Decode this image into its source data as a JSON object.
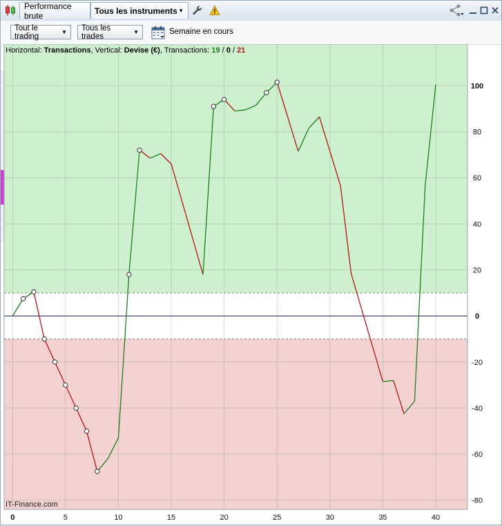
{
  "tabs": {
    "performance_label": "Performance brute",
    "instruments_label": "Tous les instruments"
  },
  "toolbar": {
    "trading_filter": "Tout le trading",
    "trades_filter": "Tous les trades",
    "period_label": "Semaine en cours"
  },
  "info": {
    "horizontal_prefix": "Horizontal: ",
    "horizontal_value": "Transactions",
    "vertical_prefix": ", Vertical: ",
    "vertical_value": "Devise (€)",
    "transactions_prefix": ", Transactions: ",
    "wins": "19",
    "sep1": " / ",
    "neutral": "0",
    "sep2": " / ",
    "losses": "21"
  },
  "brand": "IT-Finance.com",
  "colors": {
    "profit_zone": "#cef0ce",
    "loss_zone": "#f4d2d2",
    "up_line": "#1e7d1e",
    "down_line": "#b01414",
    "wins_text": "#1e7d1e",
    "losses_text": "#b01414"
  },
  "icons": {
    "chart": "candlestick-icon",
    "wrench": "wrench-icon",
    "warning": "warning-icon",
    "share": "share-icon",
    "calendar": "calendar-icon"
  },
  "chart_data": {
    "type": "line",
    "xlabel": "Transactions",
    "ylabel": "Devise (€)",
    "xlim": [
      -0.8,
      43
    ],
    "ylim": [
      -84,
      118
    ],
    "xticks": [
      "0",
      "5",
      "10",
      "15",
      "20",
      "25",
      "30",
      "35",
      "40"
    ],
    "yticks": [
      "100",
      "80",
      "60",
      "40",
      "20",
      "0",
      "-20",
      "-40",
      "-60",
      "-80"
    ],
    "profit_threshold": 10,
    "loss_threshold": -10,
    "grid": true,
    "points": [
      {
        "x": 0,
        "y": 0,
        "m": false
      },
      {
        "x": 1,
        "y": 7.5,
        "m": true
      },
      {
        "x": 2,
        "y": 10.5,
        "m": true
      },
      {
        "x": 3,
        "y": -10,
        "m": true
      },
      {
        "x": 4,
        "y": -20,
        "m": true
      },
      {
        "x": 5,
        "y": -30,
        "m": true
      },
      {
        "x": 6,
        "y": -40,
        "m": true
      },
      {
        "x": 7,
        "y": -50,
        "m": true
      },
      {
        "x": 8,
        "y": -67.5,
        "m": true
      },
      {
        "x": 9,
        "y": -62,
        "m": false
      },
      {
        "x": 10,
        "y": -53,
        "m": false
      },
      {
        "x": 11,
        "y": 18,
        "m": true
      },
      {
        "x": 12,
        "y": 72,
        "m": true
      },
      {
        "x": 13,
        "y": 68.5,
        "m": false
      },
      {
        "x": 14,
        "y": 70.5,
        "m": false
      },
      {
        "x": 15,
        "y": 66,
        "m": false
      },
      {
        "x": 18,
        "y": 18,
        "m": false
      },
      {
        "x": 19,
        "y": 91,
        "m": true
      },
      {
        "x": 20,
        "y": 94,
        "m": true
      },
      {
        "x": 21,
        "y": 89,
        "m": false
      },
      {
        "x": 22,
        "y": 89.5,
        "m": false
      },
      {
        "x": 23,
        "y": 91.5,
        "m": false
      },
      {
        "x": 24,
        "y": 97,
        "m": true
      },
      {
        "x": 25,
        "y": 101.5,
        "m": true
      },
      {
        "x": 27,
        "y": 71.5,
        "m": false
      },
      {
        "x": 28,
        "y": 81.5,
        "m": false
      },
      {
        "x": 29,
        "y": 86.5,
        "m": false
      },
      {
        "x": 31,
        "y": 56.5,
        "m": false
      },
      {
        "x": 32,
        "y": 18.5,
        "m": false
      },
      {
        "x": 35,
        "y": -28.5,
        "m": false
      },
      {
        "x": 36,
        "y": -28,
        "m": false
      },
      {
        "x": 37,
        "y": -42.5,
        "m": false
      },
      {
        "x": 38,
        "y": -37,
        "m": false
      },
      {
        "x": 39,
        "y": 56.5,
        "m": false
      },
      {
        "x": 40,
        "y": 100.5,
        "m": false
      }
    ]
  }
}
